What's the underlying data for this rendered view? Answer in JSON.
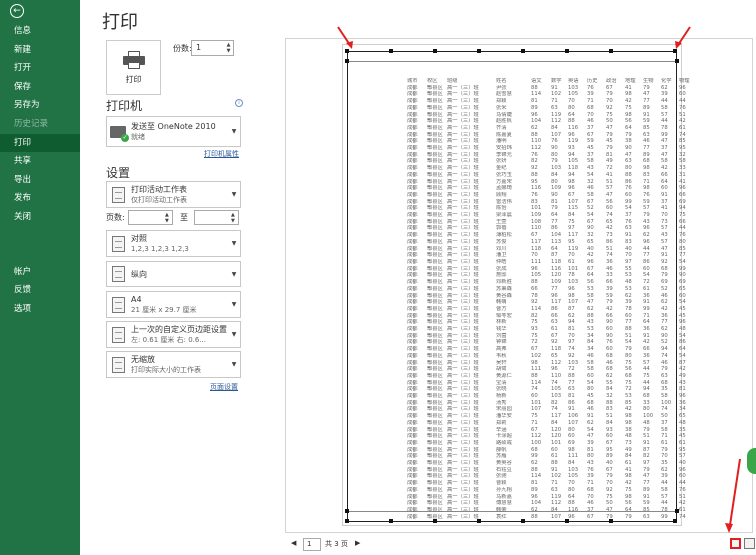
{
  "nav": {
    "back_icon": "back-arrow-icon",
    "items": [
      {
        "label": "信息",
        "state": "normal"
      },
      {
        "label": "新建",
        "state": "normal"
      },
      {
        "label": "打开",
        "state": "normal"
      },
      {
        "label": "保存",
        "state": "normal"
      },
      {
        "label": "另存为",
        "state": "normal"
      },
      {
        "label": "历史记录",
        "state": "disabled"
      },
      {
        "label": "打印",
        "state": "active"
      },
      {
        "label": "共享",
        "state": "normal"
      },
      {
        "label": "导出",
        "state": "normal"
      },
      {
        "label": "发布",
        "state": "normal"
      },
      {
        "label": "关闭",
        "state": "normal"
      }
    ],
    "footer_items": [
      {
        "label": "帐户"
      },
      {
        "label": "反馈"
      },
      {
        "label": "选项"
      }
    ],
    "colors": {
      "background": "#217346",
      "active": "#0e5c2f"
    }
  },
  "print": {
    "title": "打印",
    "button_label": "打印",
    "copies_label": "份数:",
    "copies_value": "1"
  },
  "printer": {
    "heading": "打印机",
    "name": "发送至 OneNote 2010",
    "status": "就绪",
    "properties_link": "打印机属性"
  },
  "settings": {
    "heading": "设置",
    "scope": {
      "title": "打印活动工作表",
      "subtitle": "仅打印活动工作表"
    },
    "pages_label": "页数:",
    "pages_to_label": "至",
    "collate": {
      "title": "对照",
      "subtitle": "1,2,3    1,2,3    1,2,3"
    },
    "orientation": {
      "title": "纵向"
    },
    "paper": {
      "title": "A4",
      "subtitle": "21 厘米 x 29.7 厘米"
    },
    "margins": {
      "title": "上一次的自定义页边距设置",
      "subtitle": "左: 0.61 厘米    右: 0.6..."
    },
    "scaling": {
      "title": "无缩放",
      "subtitle": "打印实际大小的工作表"
    },
    "page_setup_link": "页面设置"
  },
  "preview": {
    "headers": [
      "城市",
      "校区",
      "班级",
      "姓名",
      "语文",
      "数学",
      "英语",
      "历史",
      "政治",
      "地理",
      "生物",
      "化学",
      "物理"
    ],
    "city": "成都",
    "campus": "郫县区",
    "cls": "高一（三）班",
    "names": [
      "尹张",
      "赵雪慧",
      "郑颖",
      "张米",
      "马倩婕",
      "赵胜帆",
      "齐清",
      "陈嘉夏",
      "潘明",
      "安招玮",
      "李锦元",
      "张妍",
      "金纪",
      "张巧玉",
      "方嘉宋",
      "孟娜琦",
      "顾翔",
      "雷洁伟",
      "陈怡",
      "梁泽晨",
      "王萱",
      "郭蓓",
      "薄柏松",
      "苏俊",
      "邓川",
      "潘卫",
      "仲皓",
      "张成",
      "詹邸",
      "邓新胜",
      "苏秉森",
      "黄谷森",
      "韩萌",
      "曹方",
      "邹苓宏",
      "林新",
      "钱华",
      "刘茵",
      "钟锦",
      "高弗",
      "韦秋",
      "吴轩",
      "胡鹭",
      "黄源仁",
      "宝清",
      "张晓",
      "杨新",
      "汤秀",
      "宋丽园",
      "潘华安",
      "郑莉",
      "辛涵",
      "卡涂超",
      "路硕彧",
      "薛帆",
      "苏雁",
      "黄英谷",
      "石钰豆",
      "张驰",
      "曹颖",
      "孙九翔",
      "马新嘉",
      "傅慧慧",
      "韩荣",
      "袁红"
    ],
    "scores": [
      [
        88,
        91,
        103,
        76,
        67,
        41,
        79,
        62,
        96
      ],
      [
        114,
        102,
        105,
        39,
        79,
        98,
        47,
        39,
        60
      ],
      [
        81,
        71,
        70,
        71,
        70,
        42,
        77,
        44,
        44
      ],
      [
        89,
        63,
        80,
        68,
        92,
        75,
        89,
        58,
        76
      ],
      [
        96,
        119,
        64,
        70,
        75,
        98,
        91,
        57,
        51
      ],
      [
        104,
        112,
        88,
        46,
        50,
        56,
        59,
        44,
        42
      ],
      [
        62,
        84,
        116,
        37,
        47,
        64,
        85,
        78,
        61
      ],
      [
        88,
        107,
        96,
        67,
        79,
        79,
        63,
        99,
        74
      ],
      [
        110,
        76,
        119,
        59,
        45,
        38,
        46,
        47,
        85
      ],
      [
        112,
        90,
        93,
        45,
        79,
        90,
        77,
        37,
        95
      ],
      [
        76,
        80,
        94,
        37,
        81,
        47,
        89,
        47,
        32
      ],
      [
        82,
        79,
        105,
        58,
        49,
        63,
        68,
        58,
        58
      ],
      [
        92,
        103,
        118,
        43,
        72,
        80,
        98,
        42,
        33
      ],
      [
        88,
        84,
        94,
        54,
        41,
        88,
        83,
        66,
        31
      ],
      [
        95,
        80,
        98,
        32,
        51,
        86,
        71,
        64,
        41
      ],
      [
        116,
        109,
        96,
        46,
        57,
        76,
        98,
        60,
        96
      ],
      [
        76,
        90,
        67,
        58,
        47,
        60,
        76,
        91,
        66
      ],
      [
        83,
        81,
        107,
        67,
        56,
        99,
        59,
        37,
        69
      ],
      [
        101,
        79,
        115,
        52,
        60,
        54,
        57,
        41,
        94
      ],
      [
        109,
        64,
        84,
        54,
        74,
        37,
        79,
        70,
        75
      ],
      [
        108,
        77,
        75,
        67,
        65,
        76,
        43,
        73,
        66
      ],
      [
        110,
        86,
        97,
        90,
        42,
        63,
        96,
        57,
        44
      ],
      [
        67,
        104,
        117,
        32,
        73,
        91,
        62,
        43,
        76
      ],
      [
        117,
        113,
        95,
        65,
        86,
        83,
        96,
        57,
        80
      ],
      [
        118,
        64,
        119,
        40,
        51,
        40,
        44,
        47,
        85
      ],
      [
        70,
        87,
        70,
        42,
        74,
        70,
        77,
        91,
        77
      ],
      [
        111,
        118,
        61,
        96,
        36,
        97,
        86,
        92,
        54
      ],
      [
        96,
        116,
        101,
        67,
        46,
        55,
        60,
        68,
        99
      ],
      [
        105,
        120,
        78,
        64,
        33,
        53,
        54,
        79,
        90
      ],
      [
        88,
        109,
        103,
        56,
        66,
        48,
        72,
        69,
        69
      ],
      [
        66,
        77,
        96,
        53,
        39,
        53,
        61,
        52,
        65
      ],
      [
        78,
        96,
        98,
        58,
        59,
        62,
        36,
        46,
        60
      ],
      [
        92,
        117,
        107,
        47,
        79,
        39,
        91,
        62,
        54
      ],
      [
        114,
        86,
        87,
        62,
        42,
        78,
        99,
        42,
        45
      ],
      [
        82,
        66,
        62,
        88,
        66,
        60,
        71,
        36,
        45
      ],
      [
        75,
        63,
        94,
        43,
        90,
        77,
        64,
        77,
        96
      ],
      [
        93,
        61,
        81,
        53,
        60,
        88,
        36,
        62,
        48
      ],
      [
        75,
        67,
        70,
        34,
        90,
        51,
        91,
        90,
        54
      ],
      [
        72,
        92,
        97,
        84,
        76,
        54,
        42,
        52,
        86
      ],
      [
        67,
        118,
        74,
        34,
        60,
        79,
        66,
        94,
        64
      ],
      [
        102,
        65,
        92,
        46,
        68,
        80,
        36,
        74,
        54
      ],
      [
        98,
        112,
        103,
        58,
        46,
        75,
        57,
        46,
        87
      ],
      [
        111,
        96,
        72,
        58,
        68,
        56,
        44,
        79,
        42
      ],
      [
        88,
        110,
        88,
        60,
        62,
        68,
        75,
        63,
        49
      ],
      [
        114,
        74,
        77,
        54,
        55,
        75,
        44,
        68,
        43
      ],
      [
        74,
        105,
        63,
        80,
        84,
        72,
        94,
        35,
        81
      ],
      [
        60,
        103,
        81,
        45,
        32,
        53,
        68,
        58,
        96
      ],
      [
        101,
        82,
        86,
        68,
        88,
        85,
        33,
        100,
        36
      ],
      [
        107,
        74,
        91,
        46,
        83,
        42,
        80,
        74,
        34
      ],
      [
        75,
        117,
        106,
        91,
        51,
        98,
        100,
        50,
        65
      ],
      [
        71,
        84,
        107,
        62,
        84,
        98,
        48,
        37,
        48
      ],
      [
        67,
        120,
        80,
        54,
        93,
        38,
        79,
        58,
        35
      ],
      [
        112,
        120,
        60,
        47,
        60,
        48,
        51,
        71,
        45
      ],
      [
        100,
        101,
        69,
        39,
        67,
        73,
        91,
        61,
        61
      ],
      [
        68,
        60,
        98,
        81,
        95,
        49,
        87,
        79,
        95
      ],
      [
        99,
        61,
        111,
        80,
        89,
        84,
        82,
        70,
        57
      ],
      [
        62,
        88,
        84,
        43,
        40,
        61,
        97,
        35,
        40
      ]
    ],
    "colors": {
      "margin_lines": "#222222",
      "page_border": "#cfcfcf"
    }
  },
  "page_nav": {
    "prev": "◀",
    "page": "1",
    "total_label": "共 3 页",
    "next": "▶"
  },
  "annotations": {
    "arrow_color": "#e02020"
  }
}
